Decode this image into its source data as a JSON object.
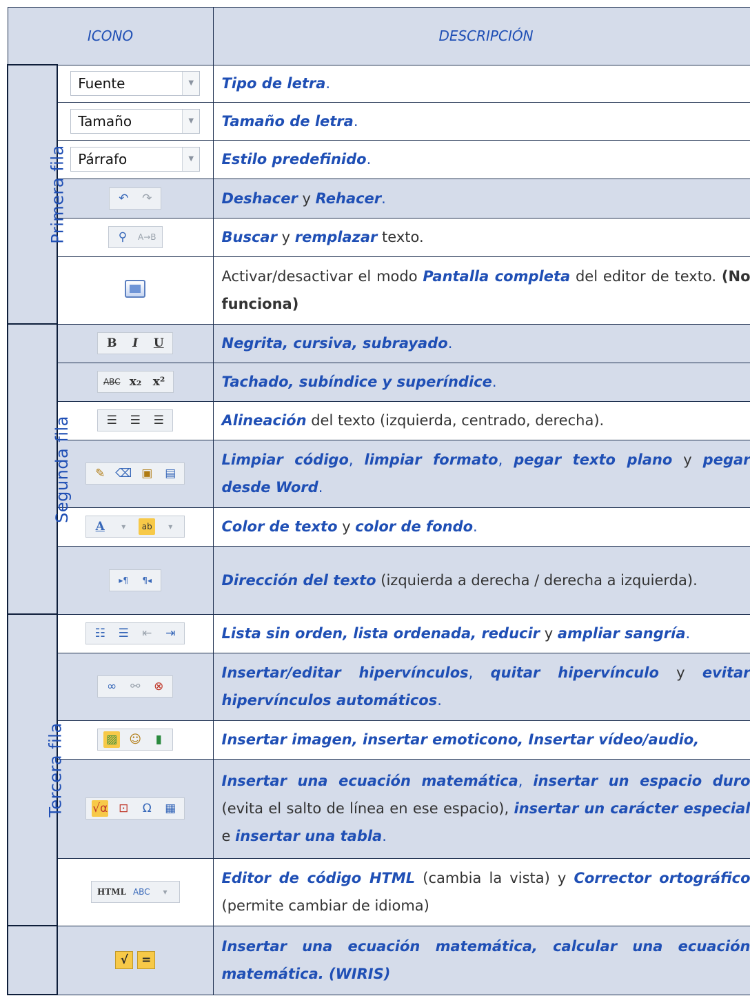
{
  "header": {
    "icon_col": "ICONO",
    "desc_col": "DESCRIPCIÓN"
  },
  "sections": [
    {
      "label": "Primera fila"
    },
    {
      "label": "Segunda fila"
    },
    {
      "label": "Tercera fila"
    },
    {
      "label": ""
    }
  ],
  "dropdowns": {
    "font": "Fuente",
    "size": "Tamaño",
    "format": "Párrafo"
  },
  "rows": {
    "r1": {
      "kw1": "Tipo de letra",
      "end": "."
    },
    "r2": {
      "kw1": "Tamaño de letra",
      "end": "."
    },
    "r3": {
      "kw1": "Estilo predefinido",
      "end": "."
    },
    "r4": {
      "kw1": "Deshacer",
      "t1": " y ",
      "kw2": "Rehacer",
      "end": "."
    },
    "r5": {
      "kw1": "Buscar",
      "t1": " y ",
      "kw2": "remplazar",
      "t2": " texto."
    },
    "r6": {
      "t0": "Activar/desactivar el modo ",
      "kw1": "Pantalla completa",
      "t1": " del editor de texto. ",
      "b1": "(No funciona)"
    },
    "r7": {
      "kw1": "Negrita, cursiva, subrayado",
      "end": "."
    },
    "r8": {
      "kw1": "Tachado, subíndice y superíndice",
      "end": "."
    },
    "r9": {
      "kw1": "Alineación",
      "t1": " del texto (izquierda, centrado, derecha)."
    },
    "r10": {
      "kw1": "Limpiar código",
      "t1": ", ",
      "kw2": "limpiar formato",
      "t2": ", ",
      "kw3": "pegar texto plano",
      "t3": " y ",
      "kw4": "pegar desde Word",
      "end": "."
    },
    "r11": {
      "kw1": "Color de texto",
      "t1": " y ",
      "kw2": "color de fondo",
      "end": "."
    },
    "r12": {
      "kw1": "Dirección del texto",
      "t1": " (izquierda a derecha / derecha a izquierda)."
    },
    "r13": {
      "kw1": "Lista sin orden, lista ordenada, reducir",
      "t1": " y ",
      "kw2": "ampliar sangría",
      "end": "."
    },
    "r14": {
      "kw1": "Insertar/editar hipervínculos",
      "t1": ", ",
      "kw2": "quitar hipervínculo",
      "t2": " y ",
      "kw3": "evitar hipervínculos automáticos",
      "end": "."
    },
    "r15": {
      "kw1": "Insertar imagen, insertar emoticono, Insertar vídeo/audio,",
      "end": ""
    },
    "r16": {
      "kw1": "Insertar una ecuación matemática",
      "t1": ", ",
      "kw2": "insertar un espacio duro",
      "t2": " (evita el salto de línea en ese espacio), ",
      "kw3": "insertar un carácter especial",
      "t3": " e ",
      "kw4": "insertar una tabla",
      "end": "."
    },
    "r17": {
      "kw1": "Editor de código HTML",
      "t1": " (cambia la vista) y ",
      "kw2": "Corrector ortográfico",
      "t2": " (permite cambiar de idioma)"
    },
    "r18": {
      "kw1": "Insertar una ecuación matemática, calcular una ecuación matemática. (WIRIS)",
      "end": ""
    }
  },
  "icons": {
    "bold": "B",
    "italic": "I",
    "underline": "U",
    "strike": "ABC",
    "sub": "x₂",
    "sup": "x²",
    "html": "HTML",
    "abc": "ABC"
  }
}
